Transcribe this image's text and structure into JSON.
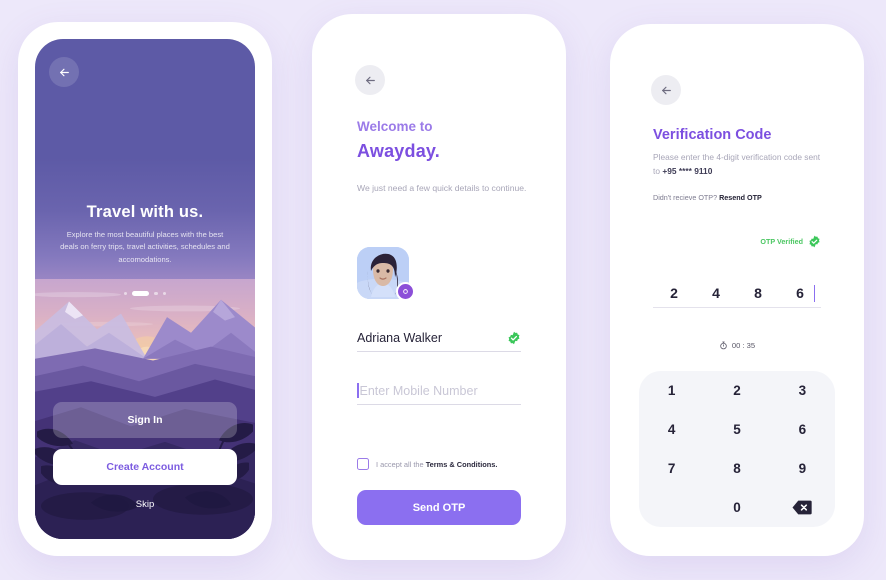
{
  "palette": {
    "page_bg": "#EDE8FA",
    "accent_purple": "#8B6FF0",
    "title_purple": "#7C4FE0",
    "light_purple": "#9B7BE8",
    "success_green": "#4CC763",
    "dark_text": "#262338",
    "muted_text": "#A8A6B8"
  },
  "screen1": {
    "back_icon": "arrow-left-icon",
    "title": "Travel with us.",
    "subtitle": "Explore the most beautiful places with the best deals on ferry trips, travel activities, schedules and accomodations.",
    "pagination": {
      "count": 4,
      "active_index": 1
    },
    "sign_in_label": "Sign In",
    "create_account_label": "Create Account",
    "skip_label": "Skip"
  },
  "screen2": {
    "back_icon": "arrow-left-icon",
    "welcome_small": "Welcome to",
    "welcome_large": "Awayday.",
    "description": "We just need a few quick details to continue.",
    "avatar": {
      "name": "user-avatar",
      "camera_badge_icon": "camera-icon"
    },
    "name_field": {
      "value": "Adriana Walker",
      "verified_icon": "verified-check-icon"
    },
    "phone_field": {
      "value": "",
      "placeholder": "Enter Mobile Number"
    },
    "terms": {
      "checked": false,
      "prefix": "I accept all the ",
      "link": "Terms & Conditions."
    },
    "submit_label": "Send OTP"
  },
  "screen3": {
    "back_icon": "arrow-left-icon",
    "title": "Verification Code",
    "description_prefix": "Please enter the 4-digit verification code sent to ",
    "phone_masked": "+95 **** 9110",
    "resend_prefix": "Didn't recieve OTP? ",
    "resend_label": "Resend OTP",
    "verified_label": "OTP Verified",
    "verified_icon": "verified-check-icon",
    "otp_digits": [
      "2",
      "4",
      "8",
      "6"
    ],
    "active_cell_index": 3,
    "timer_icon": "stopwatch-icon",
    "timer_value": "00 : 35",
    "keypad": [
      "1",
      "2",
      "3",
      "4",
      "5",
      "6",
      "7",
      "8",
      "9",
      "",
      "0",
      "delete"
    ],
    "delete_icon": "backspace-icon"
  }
}
